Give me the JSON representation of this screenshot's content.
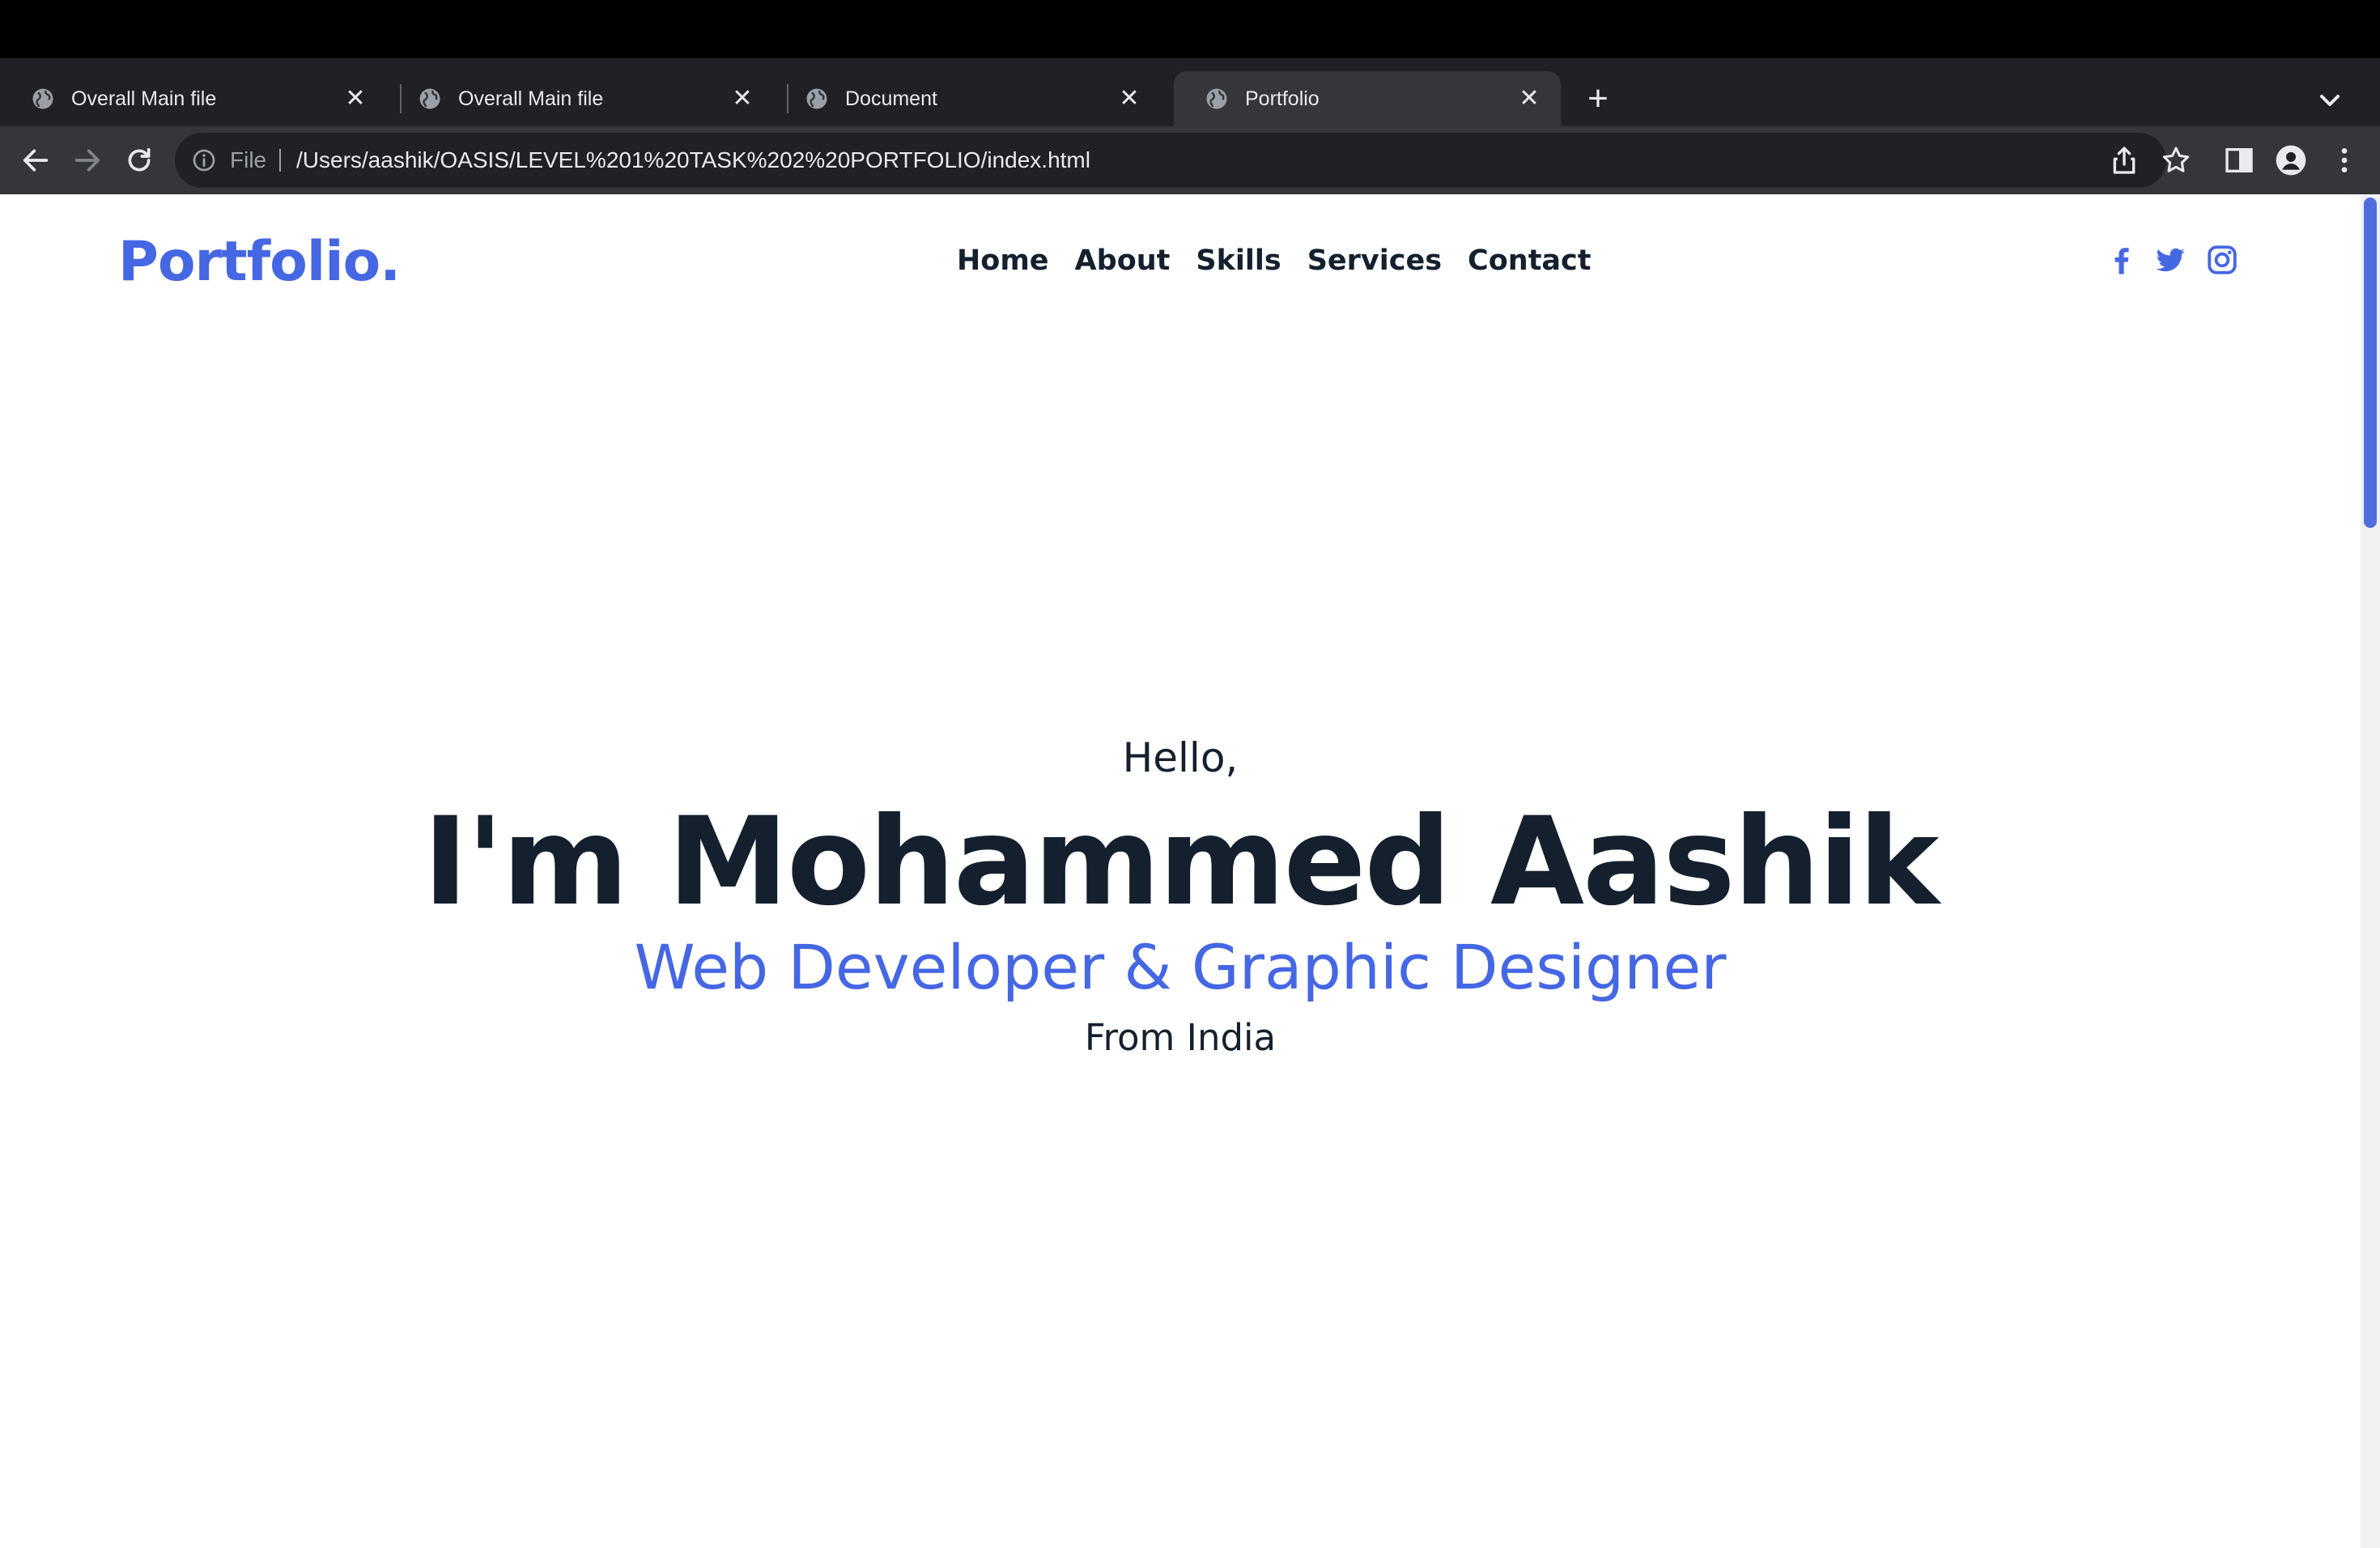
{
  "browser": {
    "tabs": [
      {
        "title": "Overall Main file",
        "active": false
      },
      {
        "title": "Overall Main file",
        "active": false
      },
      {
        "title": "Document",
        "active": false
      },
      {
        "title": "Portfolio",
        "active": true
      }
    ],
    "tab_close_glyph": "✕",
    "new_tab_glyph": "+",
    "omnibox": {
      "scheme_label": "File",
      "url": "/Users/aashik/OASIS/LEVEL%201%20TASK%202%20PORTFOLIO/index.html"
    }
  },
  "page": {
    "logo": "Portfolio.",
    "nav": [
      "Home",
      "About",
      "Skills",
      "Services",
      "Contact"
    ],
    "social_icons": [
      "facebook-icon",
      "twitter-icon",
      "instagram-icon"
    ],
    "hero": {
      "greeting": "Hello,",
      "name": "I'm Mohammed Aashik",
      "role": "Web Developer & Graphic Designer",
      "location": "From India"
    },
    "colors": {
      "accent": "#4567e4",
      "text_dark": "#15202e",
      "tabstrip_bg": "#202124",
      "toolbar_bg": "#35363a"
    }
  }
}
